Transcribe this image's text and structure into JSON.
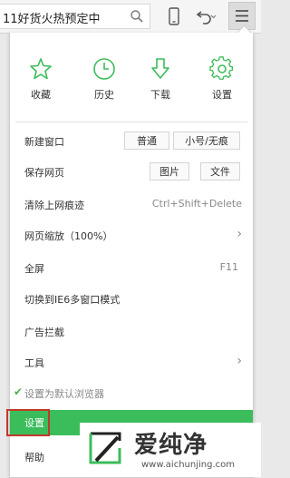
{
  "toolbar": {
    "address_text": "11好货火热预定中",
    "icons": [
      "search-icon",
      "phone-icon",
      "undo-icon",
      "menu-icon"
    ]
  },
  "menu": {
    "quick_actions": [
      {
        "label": "收藏",
        "icon": "star-icon"
      },
      {
        "label": "历史",
        "icon": "clock-icon"
      },
      {
        "label": "下载",
        "icon": "download-icon"
      },
      {
        "label": "设置",
        "icon": "gear-icon"
      }
    ],
    "new_window": {
      "label": "新建窗口",
      "options": [
        "普通",
        "小号/无痕"
      ]
    },
    "save_page": {
      "label": "保存网页",
      "options": [
        "图片",
        "文件"
      ]
    },
    "clear_traces": {
      "label": "清除上网痕迹",
      "shortcut": "Ctrl+Shift+Delete"
    },
    "zoom": {
      "label": "网页缩放（100%）"
    },
    "fullscreen": {
      "label": "全屏",
      "shortcut": "F11"
    },
    "ie6_mode": {
      "label": "切换到IE6多窗口模式"
    },
    "ad_block": {
      "label": "广告拦截"
    },
    "tools": {
      "label": "工具"
    },
    "default_browser": {
      "label": "设置为默认浏览器"
    },
    "settings": {
      "label": "设置"
    },
    "help": {
      "label": "帮助"
    }
  },
  "watermark": {
    "name": "爱纯净",
    "url": "www.aichunjing.com"
  },
  "colors": {
    "accent_green": "#3bbd5b",
    "highlight_red": "#c0392b"
  }
}
